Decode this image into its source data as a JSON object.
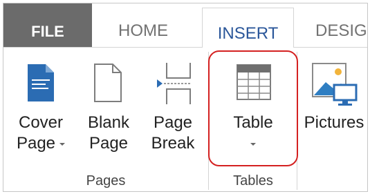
{
  "tabs": {
    "file": "FILE",
    "home": "HOME",
    "insert": "INSERT",
    "design": "DESIG"
  },
  "commands": {
    "cover_page": {
      "line1": "Cover",
      "line2": "Page",
      "icon": "cover-page-icon"
    },
    "blank_page": {
      "line1": "Blank",
      "line2": "Page",
      "icon": "blank-page-icon"
    },
    "page_break": {
      "line1": "Page",
      "line2": "Break",
      "icon": "page-break-icon"
    },
    "table": {
      "line1": "Table",
      "icon": "table-icon"
    },
    "pictures": {
      "line1": "Pictures",
      "icon": "pictures-icon"
    }
  },
  "groups": {
    "pages": "Pages",
    "tables": "Tables"
  },
  "colors": {
    "file_tab": "#6b6b6b",
    "active_tab_text": "#2b579a",
    "cover_page_icon": "#2b6cb3",
    "highlight": "#d42020"
  }
}
